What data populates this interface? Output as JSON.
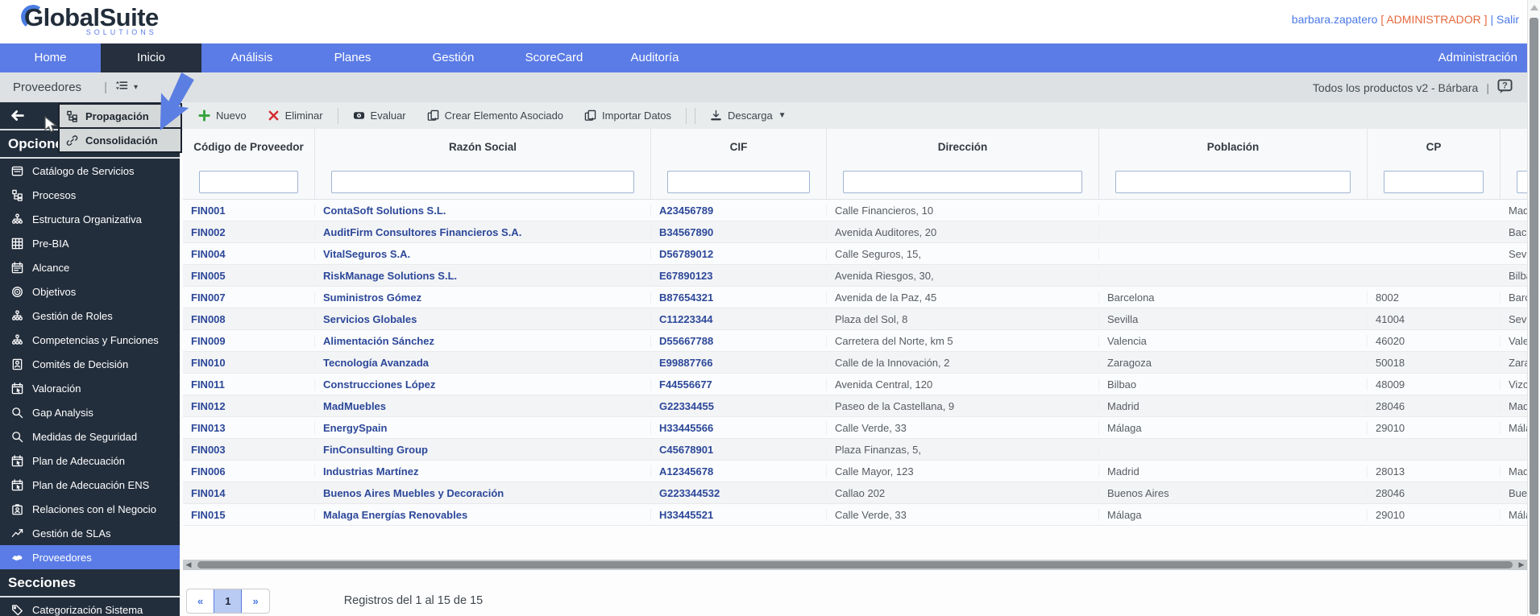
{
  "header": {
    "logo_main": "GlobalSuite",
    "logo_sub": "SOLUTIONS",
    "user": "barbara.zapatero",
    "role": "[ ADMINISTRADOR ]",
    "sep": "|",
    "logout": "Salir"
  },
  "nav": {
    "tabs": [
      {
        "label": "Home",
        "active": false
      },
      {
        "label": "Inicio",
        "active": true
      },
      {
        "label": "Análisis",
        "active": false
      },
      {
        "label": "Planes",
        "active": false
      },
      {
        "label": "Gestión",
        "active": false
      },
      {
        "label": "ScoreCard",
        "active": false
      },
      {
        "label": "Auditoría",
        "active": false
      }
    ],
    "right_tab": "Administración"
  },
  "breadcrumb": {
    "title": "Proveedores",
    "separator": "|",
    "product_label": "Todos los productos v2 - Bárbara",
    "right_separator": "|"
  },
  "popup_menu": {
    "items": [
      {
        "icon": "tree-icon",
        "label": "Propagación"
      },
      {
        "icon": "link-icon",
        "label": "Consolidación"
      }
    ]
  },
  "sidebar": {
    "sections": [
      {
        "header": "Opciones",
        "items": [
          {
            "icon": "folder-icon",
            "label": "Catálogo de Servicios",
            "active": false
          },
          {
            "icon": "tree-icon",
            "label": "Procesos",
            "active": false
          },
          {
            "icon": "org-chart-icon",
            "label": "Estructura Organizativa",
            "active": false
          },
          {
            "icon": "grid-icon",
            "label": "Pre-BIA",
            "active": false
          },
          {
            "icon": "calendar-icon",
            "label": "Alcance",
            "active": false
          },
          {
            "icon": "target-icon",
            "label": "Objetivos",
            "active": false
          },
          {
            "icon": "org-chart-icon",
            "label": "Gestión de Roles",
            "active": false
          },
          {
            "icon": "org-chart-icon",
            "label": "Competencias y Funciones",
            "active": false
          },
          {
            "icon": "id-badge-icon",
            "label": "Comités de Decisión",
            "active": false
          },
          {
            "icon": "calendar-cursor-icon",
            "label": "Valoración",
            "active": false
          },
          {
            "icon": "search-icon",
            "label": "Gap Analysis",
            "active": false
          },
          {
            "icon": "search-icon",
            "label": "Medidas de Seguridad",
            "active": false
          },
          {
            "icon": "calendar-cursor-icon",
            "label": "Plan de Adecuación",
            "active": false
          },
          {
            "icon": "calendar-cursor-icon",
            "label": "Plan de Adecuación ENS",
            "active": false
          },
          {
            "icon": "briefcase-person-icon",
            "label": "Relaciones con el Negocio",
            "active": false
          },
          {
            "icon": "line-chart-icon",
            "label": "Gestión de SLAs",
            "active": false
          },
          {
            "icon": "handshake-icon",
            "label": "Proveedores",
            "active": true
          }
        ]
      },
      {
        "header": "Secciones",
        "items": [
          {
            "icon": "tag-icon",
            "label": "Categorización Sistema",
            "active": false
          }
        ]
      }
    ]
  },
  "toolbar": {
    "buttons": [
      {
        "icon": "plus-icon",
        "label": "Nuevo",
        "sep_after": false,
        "caret": false
      },
      {
        "icon": "delete-x-icon",
        "label": "Eliminar",
        "sep_after": true,
        "caret": false
      },
      {
        "icon": "evaluate-icon",
        "label": "Evaluar",
        "sep_after": false,
        "caret": false
      },
      {
        "icon": "copy-icon",
        "label": "Crear Elemento Asociado",
        "sep_after": false,
        "caret": false
      },
      {
        "icon": "copy-icon",
        "label": "Importar Datos",
        "sep_after": true,
        "caret": false
      },
      {
        "icon": "download-icon",
        "label": "Descarga",
        "sep_after": false,
        "caret": true
      }
    ]
  },
  "table": {
    "columns": [
      "Código de Proveedor",
      "Razón Social",
      "CIF",
      "Dirección",
      "Población",
      "CP",
      ""
    ],
    "rows": [
      [
        "FIN001",
        "ContaSoft Solutions S.L.",
        "A23456789",
        "Calle Financieros, 10",
        "",
        "",
        "Madr"
      ],
      [
        "FIN002",
        "AuditFirm Consultores Financieros S.A.",
        "B34567890",
        "Avenida Auditores, 20",
        "",
        "",
        "Bacel"
      ],
      [
        "FIN004",
        "VitalSeguros S.A.",
        "D56789012",
        "Calle Seguros, 15,",
        "",
        "",
        "Sevill"
      ],
      [
        "FIN005",
        "RiskManage Solutions S.L.",
        "E67890123",
        "Avenida Riesgos, 30,",
        "",
        "",
        "Bilba"
      ],
      [
        "FIN007",
        "Suministros Gómez",
        "B87654321",
        "Avenida de la Paz, 45",
        "Barcelona",
        "8002",
        "Barce"
      ],
      [
        "FIN008",
        "Servicios Globales",
        "C11223344",
        "Plaza del Sol, 8",
        "Sevilla",
        "41004",
        "Sevill"
      ],
      [
        "FIN009",
        "Alimentación Sánchez",
        "D55667788",
        "Carretera del Norte, km 5",
        "Valencia",
        "46020",
        "Valen"
      ],
      [
        "FIN010",
        "Tecnología Avanzada",
        "E99887766",
        "Calle de la Innovación, 2",
        "Zaragoza",
        "50018",
        "Zarag"
      ],
      [
        "FIN011",
        "Construcciones López",
        "F44556677",
        "Avenida Central, 120",
        "Bilbao",
        "48009",
        "Vizca"
      ],
      [
        "FIN012",
        "MadMuebles",
        "G22334455",
        "Paseo de la Castellana, 9",
        "Madrid",
        "28046",
        "Madr"
      ],
      [
        "FIN013",
        "EnergySpain",
        "H33445566",
        "Calle Verde, 33",
        "Málaga",
        "29010",
        "Mála"
      ],
      [
        "FIN003",
        "FinConsulting Group",
        "C45678901",
        "Plaza Finanzas, 5,",
        "",
        "",
        ""
      ],
      [
        "FIN006",
        "Industrias Martínez",
        "A12345678",
        "Calle Mayor, 123",
        "Madrid",
        "28013",
        "Madr"
      ],
      [
        "FIN014",
        "Buenos Aires Muebles y Decoración",
        "G223344532",
        "Callao 202",
        "Buenos Aires",
        "28046",
        "Buen"
      ],
      [
        "FIN015",
        "Malaga Energías Renovables",
        "H33445521",
        "Calle Verde, 33",
        "Málaga",
        "29010",
        "Mála"
      ]
    ]
  },
  "pagination": {
    "prev": "«",
    "page": "1",
    "next": "»",
    "info": "Registros del 1 al 15 de 15"
  },
  "colors": {
    "accent_blue": "#5b7ce6",
    "dark_navy": "#252f3d",
    "link_blue": "#4a79e8",
    "table_link_blue": "#2c4899",
    "role_orange": "#e5683c",
    "new_green": "#3aa540",
    "delete_red": "#d42a2a"
  }
}
